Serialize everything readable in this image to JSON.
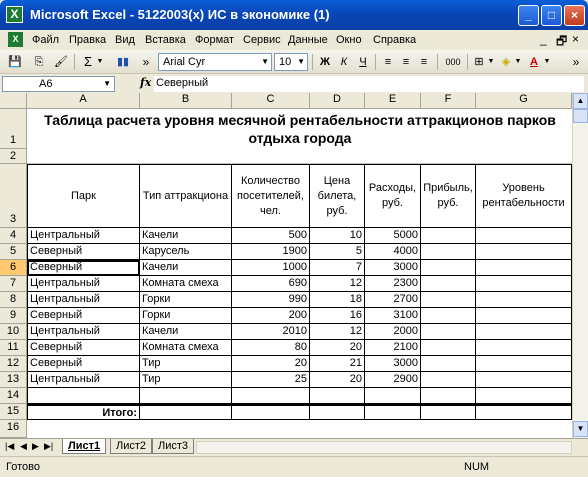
{
  "window": {
    "title": "Microsoft Excel - 5122003(x) ИС в экономике (1)"
  },
  "menu": [
    "Файл",
    "Правка",
    "Вид",
    "Вставка",
    "Формат",
    "Сервис",
    "Данные",
    "Окно",
    "Справка"
  ],
  "toolbar": {
    "font": "Arial Cyr",
    "size": "10",
    "bold": "Ж",
    "italic": "К",
    "underline": "Ч",
    "thousands": "000",
    "sigma": "Σ",
    "chevron": "»"
  },
  "formula_bar": {
    "name_box": "A6",
    "fx": "fx",
    "value": "Северный"
  },
  "columns": [
    "A",
    "B",
    "C",
    "D",
    "E",
    "F",
    "G"
  ],
  "rows": [
    "1",
    "2",
    "3",
    "4",
    "5",
    "6",
    "7",
    "8",
    "9",
    "10",
    "11",
    "12",
    "13",
    "14",
    "15",
    "16"
  ],
  "sheet": {
    "title": "Таблица расчета уровня месячной рентабельности аттракционов парков отдыха города",
    "headers": [
      "Парк",
      "Тип аттракциона",
      "Количество посетителей, чел.",
      "Цена билета, руб.",
      "Расходы, руб.",
      "Прибыль, руб.",
      "Уровень рентабельности"
    ],
    "data": [
      [
        "Центральный",
        "Качели",
        "500",
        "10",
        "5000"
      ],
      [
        "Северный",
        "Карусель",
        "1900",
        "5",
        "4000"
      ],
      [
        "Северный",
        "Качели",
        "1000",
        "7",
        "3000"
      ],
      [
        "Центральный",
        "Комната смеха",
        "690",
        "12",
        "2300"
      ],
      [
        "Центральный",
        "Горки",
        "990",
        "18",
        "2700"
      ],
      [
        "Северный",
        "Горки",
        "200",
        "16",
        "3100"
      ],
      [
        "Центральный",
        "Качели",
        "2010",
        "12",
        "2000"
      ],
      [
        "Северный",
        "Комната смеха",
        "80",
        "20",
        "2100"
      ],
      [
        "Северный",
        "Тир",
        "20",
        "21",
        "3000"
      ],
      [
        "Центральный",
        "Тир",
        "25",
        "20",
        "2900"
      ]
    ],
    "total_label": "Итого:"
  },
  "tabs": [
    "Лист1",
    "Лист2",
    "Лист3"
  ],
  "status": {
    "left": "Готово",
    "num": "NUM"
  }
}
